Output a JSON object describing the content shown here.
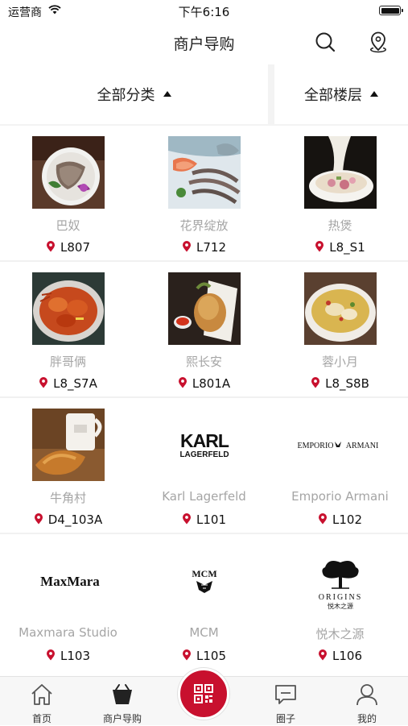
{
  "status_bar": {
    "carrier": "运营商",
    "time": "下午6:16"
  },
  "nav": {
    "title": "商户导购"
  },
  "filters": {
    "category": "全部分类",
    "floor": "全部楼层"
  },
  "stores": [
    {
      "name": "巴奴",
      "location": "L807",
      "image": "hotpot-meat-photo"
    },
    {
      "name": "花界绽放",
      "location": "L712",
      "image": "seafood-platter-photo"
    },
    {
      "name": "热煲",
      "location": "L8_S1",
      "image": "claypot-soup-photo"
    },
    {
      "name": "胖哥俩",
      "location": "L8_S7A",
      "image": "crab-pot-photo"
    },
    {
      "name": "熙长安",
      "location": "L801A",
      "image": "roast-chicken-photo"
    },
    {
      "name": "蓉小月",
      "location": "L8_S8B",
      "image": "fish-soup-photo"
    },
    {
      "name": "牛角村",
      "location": "D4_103A",
      "image": "croissant-mug-photo"
    },
    {
      "name": "Karl Lagerfeld",
      "location": "L101",
      "logo": [
        "KARL",
        "LAGERFELD"
      ]
    },
    {
      "name": "Emporio Armani",
      "location": "L102",
      "logo": [
        "EMPORIO",
        "ARMANI"
      ]
    },
    {
      "name": "Maxmara Studio",
      "location": "L103",
      "logo": [
        "MaxMara"
      ]
    },
    {
      "name": "MCM",
      "location": "L105",
      "logo": [
        "MCM"
      ]
    },
    {
      "name": "悦木之源",
      "location": "L106",
      "logo": [
        "ORIGINS",
        "悦木之源"
      ]
    }
  ],
  "tabs": [
    {
      "label": "首页",
      "icon": "home-icon"
    },
    {
      "label": "商户导购",
      "icon": "shopping-basket-icon"
    },
    {
      "label": "",
      "icon": "qr-code-icon"
    },
    {
      "label": "圈子",
      "icon": "chat-bubble-icon"
    },
    {
      "label": "我的",
      "icon": "person-icon"
    }
  ],
  "colors": {
    "accent": "#c8102e",
    "store_name": "#a5a5a5"
  }
}
